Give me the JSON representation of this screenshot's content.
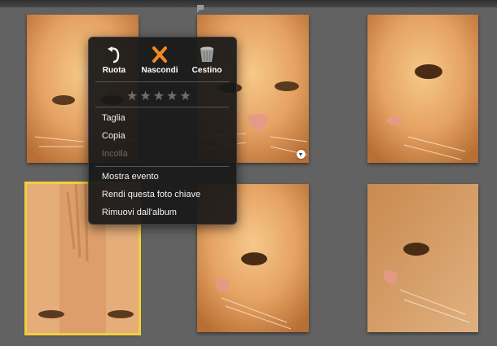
{
  "menu": {
    "tools": [
      {
        "label": "Ruota",
        "icon": "rotate-icon"
      },
      {
        "label": "Nascondi",
        "icon": "hide-x-icon"
      },
      {
        "label": "Cestino",
        "icon": "trash-icon"
      }
    ],
    "rating": {
      "stars": "★★★★★",
      "value": 0,
      "max": 5
    },
    "items": [
      {
        "label": "Taglia",
        "enabled": true
      },
      {
        "label": "Copia",
        "enabled": true
      },
      {
        "label": "Incolla",
        "enabled": false
      },
      {
        "label": "Mostra evento",
        "enabled": true
      },
      {
        "label": "Rendi questa foto chiave",
        "enabled": true
      },
      {
        "label": "Rimuovi dall'album",
        "enabled": true
      }
    ]
  },
  "photos": {
    "count": 6,
    "selected_index": 3,
    "subject": "cat-photo-icon"
  },
  "colors": {
    "background": "#626262",
    "selection": "#f1cf3c",
    "menu_bg": "#181818",
    "accent_orange": "#f08a20"
  }
}
